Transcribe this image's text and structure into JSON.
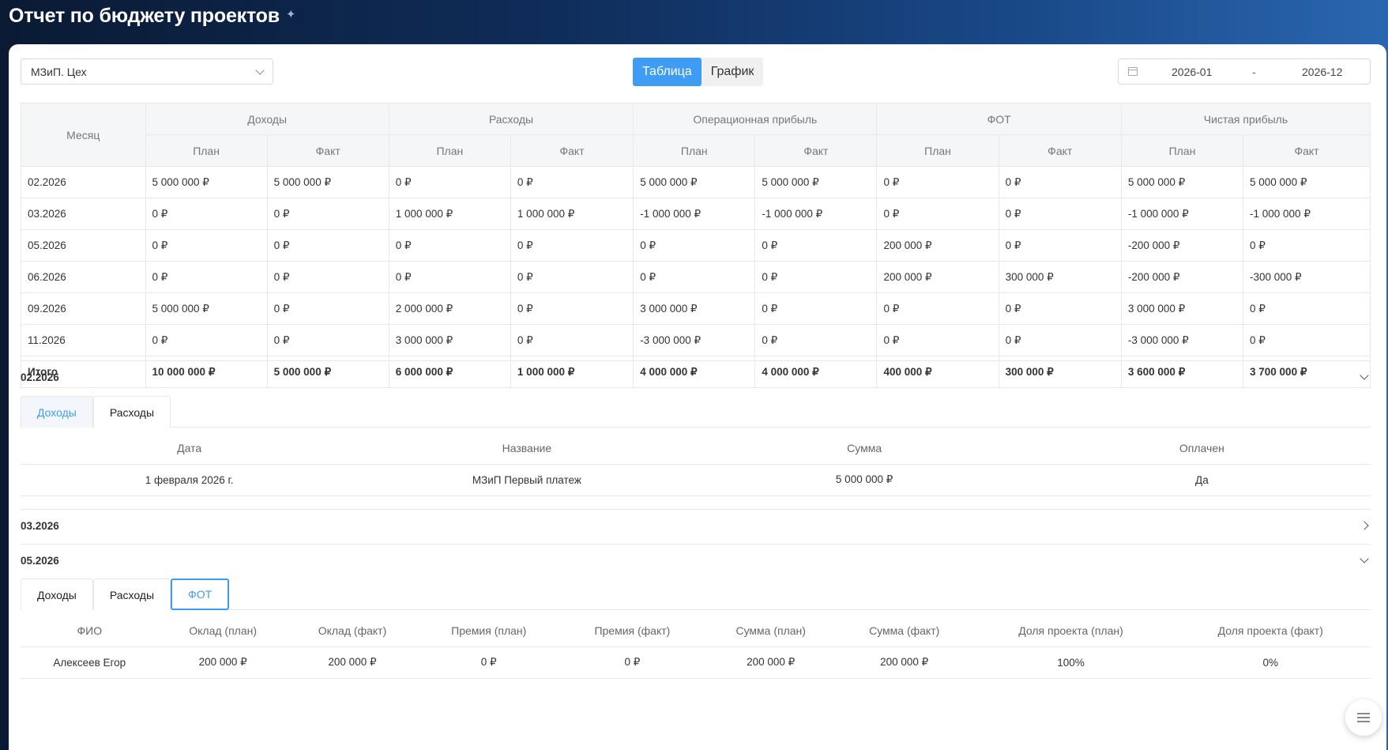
{
  "page": {
    "title": "Отчет по бюджету проектов"
  },
  "filters": {
    "project_select": "МЗиП. Цех",
    "view_tabs": [
      "Таблица",
      "График"
    ],
    "active_view": "Таблица",
    "date_from": "2026-01",
    "date_sep": "-",
    "date_to": "2026-12"
  },
  "summary": {
    "month_header": "Месяц",
    "groups": [
      "Доходы",
      "Расходы",
      "Операционная прибыль",
      "ФОТ",
      "Чистая прибыль"
    ],
    "plan_label": "План",
    "fact_label": "Факт",
    "rows": [
      {
        "month": "02.2026",
        "cells": [
          "5 000 000 ₽",
          "5 000 000 ₽",
          "0 ₽",
          "0 ₽",
          "5 000 000 ₽",
          "5 000 000 ₽",
          "0 ₽",
          "0 ₽",
          "5 000 000 ₽",
          "5 000 000 ₽"
        ],
        "net_status": [
          "pos",
          "pos"
        ]
      },
      {
        "month": "03.2026",
        "cells": [
          "0 ₽",
          "0 ₽",
          "1 000 000 ₽",
          "1 000 000 ₽",
          "-1 000 000 ₽",
          "-1 000 000 ₽",
          "0 ₽",
          "0 ₽",
          "-1 000 000 ₽",
          "-1 000 000 ₽"
        ],
        "net_status": [
          "neg",
          "neg"
        ]
      },
      {
        "month": "05.2026",
        "cells": [
          "0 ₽",
          "0 ₽",
          "0 ₽",
          "0 ₽",
          "0 ₽",
          "0 ₽",
          "200 000 ₽",
          "0 ₽",
          "-200 000 ₽",
          "0 ₽"
        ],
        "net_status": [
          "neg",
          ""
        ]
      },
      {
        "month": "06.2026",
        "cells": [
          "0 ₽",
          "0 ₽",
          "0 ₽",
          "0 ₽",
          "0 ₽",
          "0 ₽",
          "200 000 ₽",
          "300 000 ₽",
          "-200 000 ₽",
          "-300 000 ₽"
        ],
        "net_status": [
          "neg",
          "neg"
        ]
      },
      {
        "month": "09.2026",
        "cells": [
          "5 000 000 ₽",
          "0 ₽",
          "2 000 000 ₽",
          "0 ₽",
          "3 000 000 ₽",
          "0 ₽",
          "0 ₽",
          "0 ₽",
          "3 000 000 ₽",
          "0 ₽"
        ],
        "net_status": [
          "pos",
          ""
        ]
      },
      {
        "month": "11.2026",
        "cells": [
          "0 ₽",
          "0 ₽",
          "3 000 000 ₽",
          "0 ₽",
          "-3 000 000 ₽",
          "0 ₽",
          "0 ₽",
          "0 ₽",
          "-3 000 000 ₽",
          "0 ₽"
        ],
        "net_status": [
          "neg",
          ""
        ]
      }
    ],
    "total": {
      "label": "Итого",
      "cells": [
        "10 000 000 ₽",
        "5 000 000 ₽",
        "6 000 000 ₽",
        "1 000 000 ₽",
        "4 000 000 ₽",
        "4 000 000 ₽",
        "400 000 ₽",
        "300 000 ₽",
        "3 600 000 ₽",
        "3 700 000 ₽"
      ],
      "net_status": [
        "pos",
        "pos"
      ]
    }
  },
  "sections": {
    "s1": {
      "month": "02.2026",
      "tabs": [
        "Доходы",
        "Расходы"
      ],
      "columns": [
        "Дата",
        "Название",
        "Сумма",
        "Оплачен"
      ],
      "row": {
        "date": "1 февраля 2026 г.",
        "name": "МЗиП Первый платеж",
        "amount": "5 000 000 ₽",
        "paid": "Да"
      }
    },
    "s2": {
      "month": "03.2026"
    },
    "s3": {
      "month": "05.2026",
      "tabs": [
        "Доходы",
        "Расходы",
        "ФОТ"
      ],
      "columns": [
        "ФИО",
        "Оклад (план)",
        "Оклад (факт)",
        "Премия (план)",
        "Премия (факт)",
        "Сумма (план)",
        "Сумма (факт)",
        "Доля проекта (план)",
        "Доля проекта (факт)"
      ],
      "row": [
        "Алексеев Егор",
        "200 000 ₽",
        "200 000 ₽",
        "0 ₽",
        "0 ₽",
        "200 000 ₽",
        "200 000 ₽",
        "100%",
        "0%"
      ]
    }
  },
  "colors": {
    "accent": "#3f9cf5",
    "positive": "#1a8f1a",
    "negative": "#e01b1b",
    "link": "#1d5fb0"
  }
}
